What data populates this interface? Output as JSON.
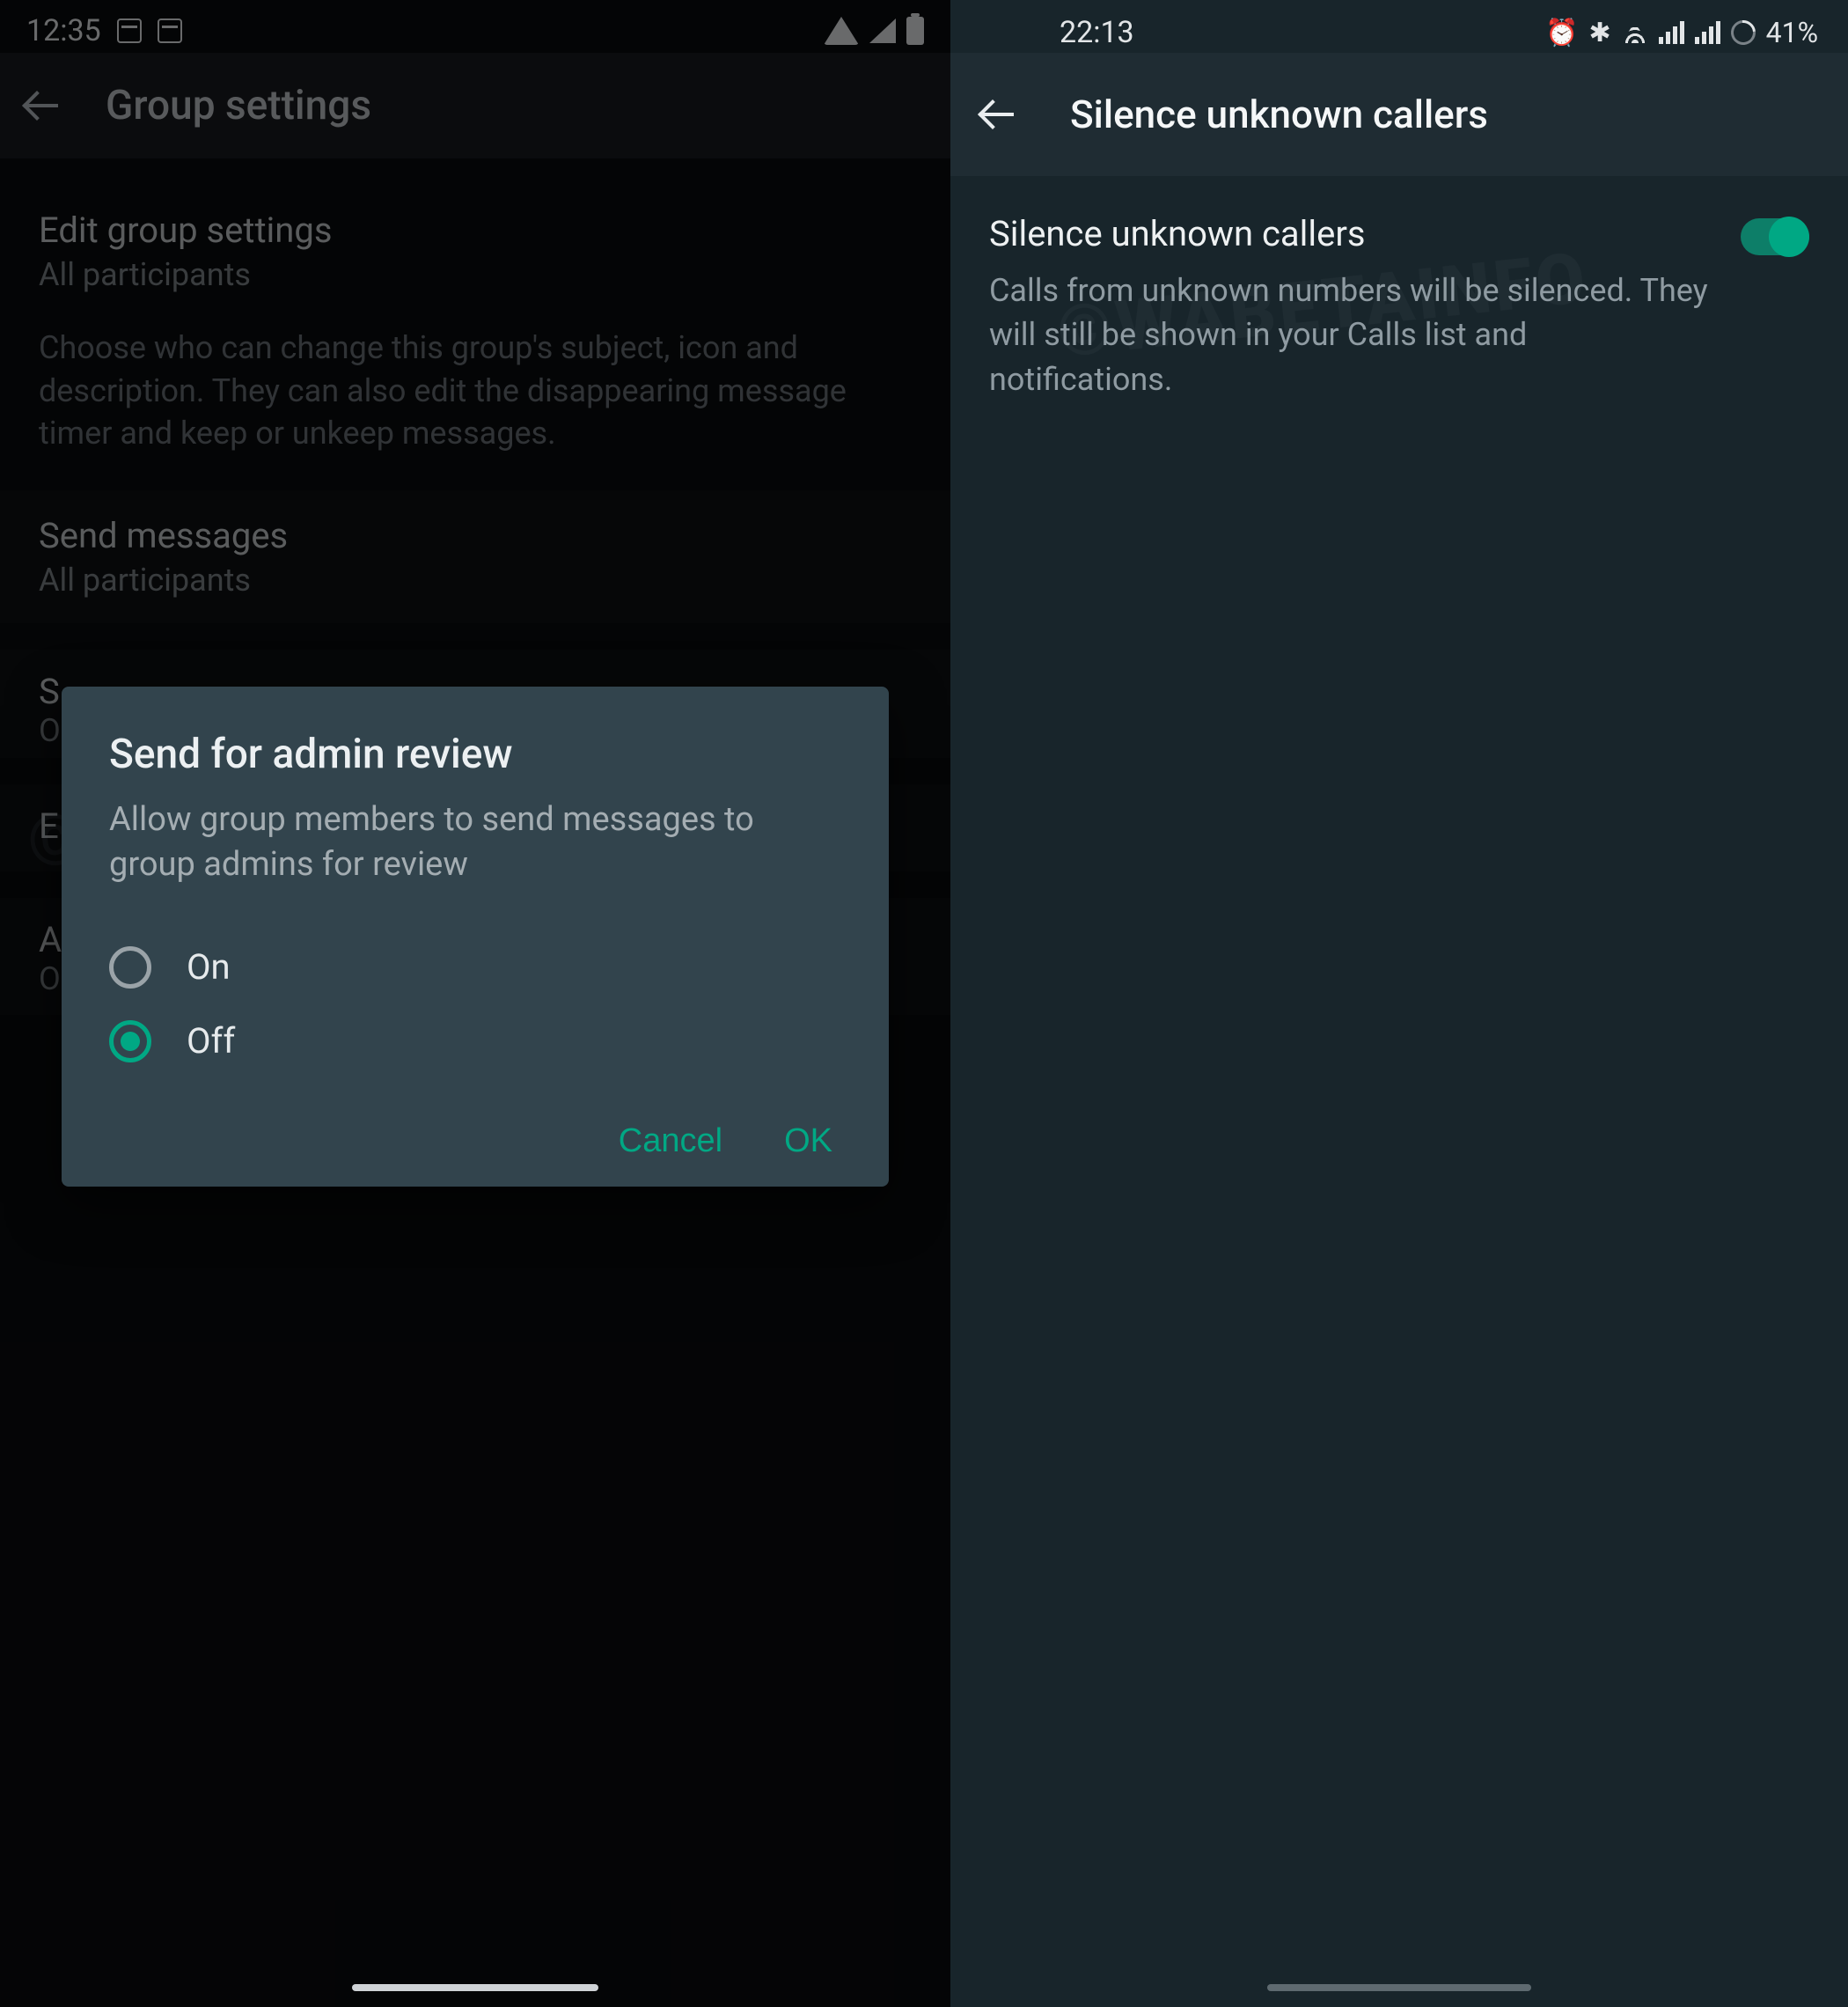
{
  "watermark": "©WABETAINFO",
  "left": {
    "status": {
      "time": "12:35"
    },
    "appbar_title": "Group settings",
    "edit_group": {
      "title": "Edit group settings",
      "subtitle": "All participants",
      "description": "Choose who can change this group's subject, icon and description. They can also edit the disappearing message timer and keep or unkeep messages."
    },
    "send_messages": {
      "title": "Send messages",
      "subtitle": "All participants"
    },
    "row_s": {
      "title": "S",
      "subtitle": "O"
    },
    "row_e": {
      "title": "E"
    },
    "row_a": {
      "title": "A",
      "subtitle": "O"
    },
    "dialog": {
      "title": "Send for admin review",
      "description": "Allow group members to send messages to group admins for review",
      "option_on": "On",
      "option_off": "Off",
      "selected": "off",
      "cancel": "Cancel",
      "ok": "OK"
    }
  },
  "right": {
    "status": {
      "time": "22:13",
      "battery_pct": "41%"
    },
    "appbar_title": "Silence unknown callers",
    "setting": {
      "title": "Silence unknown callers",
      "description": "Calls from unknown numbers will be silenced. They will still be shown in your Calls list and notifications.",
      "enabled": true
    }
  }
}
